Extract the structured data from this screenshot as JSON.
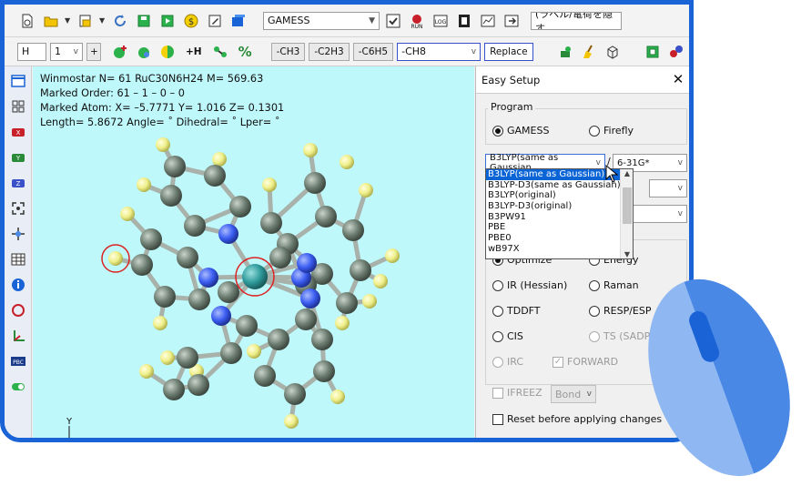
{
  "toolbar1": {
    "program_combo": "GAMESS",
    "label_combo": "(ラベル/電荷を隠す"
  },
  "toolbar2": {
    "element_combo": "H",
    "count_combo": "1",
    "plus_label": "+",
    "add_h_label": "+H",
    "percent_label": "%",
    "groups": [
      "-CH3",
      "-C2H3",
      "-C6H5"
    ],
    "group_combo": "-CH8",
    "replace_label": "Replace"
  },
  "viewport": {
    "line1": "Winmostar  N= 61  RuC30N6H24  M= 569.63",
    "line2": "Marked Order: 61 – 1 – 0 – 0",
    "line3": "Marked Atom: X= –5.7771  Y= 1.016  Z= 0.1301",
    "line4": "Length= 5.8672  Angle= ˚  Dihedral= ˚  Lper= ˚",
    "axis_label": "Y"
  },
  "panel": {
    "title": "Easy Setup",
    "close": "✕",
    "program_group": "Program",
    "program_options": [
      "GAMESS",
      "Firefly"
    ],
    "program_selected": "GAMESS",
    "method_combo": "B3LYP(same as Gaussian",
    "slash": "/",
    "basis_combo": "6-31G*",
    "method_list": [
      "B3LYP(same as Gaussian)",
      "B3LYP-D3(same as Gaussian)",
      "B3LYP(original)",
      "B3LYP-D3(original)",
      "B3PW91",
      "PBE",
      "PBE0",
      "wB97X"
    ],
    "method_selected_index": 0,
    "tasks": {
      "optimize": "Optimize",
      "energy": "Energy",
      "ir": "IR (Hessian)",
      "raman": "Raman",
      "tddft": "TDDFT",
      "resp": "RESP/ESP",
      "cis": "CIS",
      "ts": "TS (SADPOINT",
      "irc": "IRC",
      "forward": "FORWARD"
    },
    "ifreez_label": "IFREEZ",
    "bond_combo": "Bond",
    "reset_label": "Reset before applying changes"
  },
  "colors": {
    "frame": "#1a63d6",
    "viewport_bg": "#bff8fb",
    "carbon": "#6b7b6f",
    "hydrogen": "#f3f39a",
    "nitrogen": "#3a5cf0",
    "ruthenium": "#2e9a9a",
    "mouse_light": "#8fb8f2",
    "mouse_dark": "#4a88e6"
  }
}
